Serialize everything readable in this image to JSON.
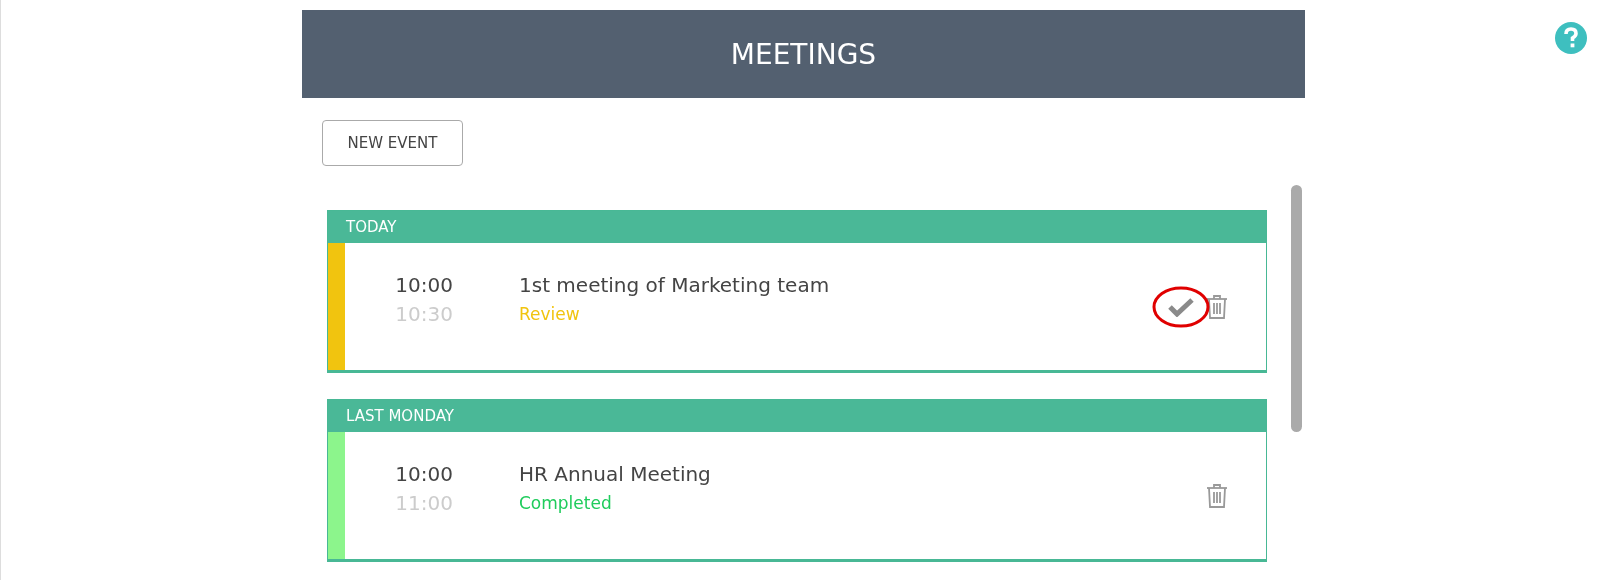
{
  "header": {
    "title": "MEETINGS"
  },
  "new_event_button": "NEW EVENT",
  "groups": [
    {
      "label": "TODAY",
      "events": [
        {
          "start": "10:00",
          "end": "10:30",
          "title": "1st meeting of Marketing team",
          "status": "Review",
          "kind": "review",
          "color": "#f1c40f",
          "can_complete": true,
          "highlighted": true
        }
      ]
    },
    {
      "label": "LAST MONDAY",
      "events": [
        {
          "start": "10:00",
          "end": "11:00",
          "title": "HR Annual Meeting",
          "status": "Completed",
          "kind": "completed",
          "color": "#8cf58c",
          "can_complete": false,
          "highlighted": false
        }
      ]
    }
  ]
}
